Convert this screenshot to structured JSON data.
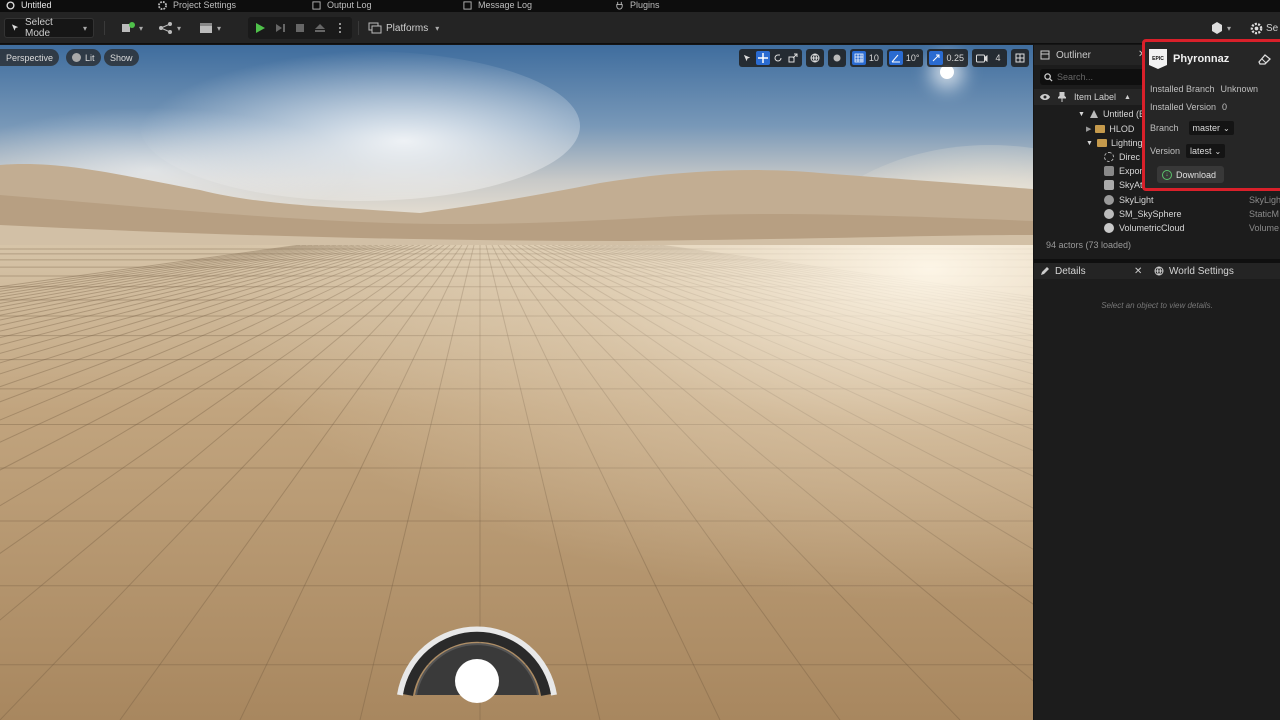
{
  "tabs": [
    {
      "label": "Untitled",
      "icon": "unreal-logo-icon"
    },
    {
      "label": "Project Settings",
      "icon": "settings-icon"
    },
    {
      "label": "Output Log",
      "icon": "log-icon"
    },
    {
      "label": "Message Log",
      "icon": "message-icon"
    },
    {
      "label": "Plugins",
      "icon": "plug-icon"
    }
  ],
  "toolbar": {
    "select_mode": "Select Mode",
    "platforms": "Platforms",
    "settings": "Se"
  },
  "viewport": {
    "perspective": "Perspective",
    "lit": "Lit",
    "show": "Show",
    "grid_snap": "10",
    "rotation_snap": "10°",
    "scale_snap": "0.25",
    "camera_speed": "4"
  },
  "outliner": {
    "title": "Outliner",
    "search_placeholder": "Search...",
    "column": "Item Label",
    "items": [
      {
        "label": "Untitled (E",
        "type": ""
      },
      {
        "label": "HLOD",
        "type": ""
      },
      {
        "label": "Lighting",
        "type": ""
      },
      {
        "label": "Direc",
        "type": ""
      },
      {
        "label": "Expon",
        "type": ""
      },
      {
        "label": "SkyAt",
        "type": ""
      },
      {
        "label": "SkyLight",
        "type": "SkyLigh"
      },
      {
        "label": "SM_SkySphere",
        "type": "StaticM"
      },
      {
        "label": "VolumetricCloud",
        "type": "Volume"
      }
    ],
    "actors": "94 actors (73 loaded)"
  },
  "details": {
    "tab": "Details",
    "world_tab": "World Settings",
    "empty": "Select an object to view details."
  },
  "plugin": {
    "logo_text": "EPIC",
    "title": "Phyronnaz",
    "installed_branch_label": "Installed Branch",
    "installed_branch": "Unknown",
    "installed_version_label": "Installed Version",
    "installed_version": "0",
    "branch_label": "Branch",
    "branch": "master",
    "version_label": "Version",
    "version": "latest",
    "download": "Download"
  },
  "colors": {
    "accent_blue": "#2a6bd1",
    "highlight_red": "#d9202a",
    "play_green": "#4fc14a"
  }
}
